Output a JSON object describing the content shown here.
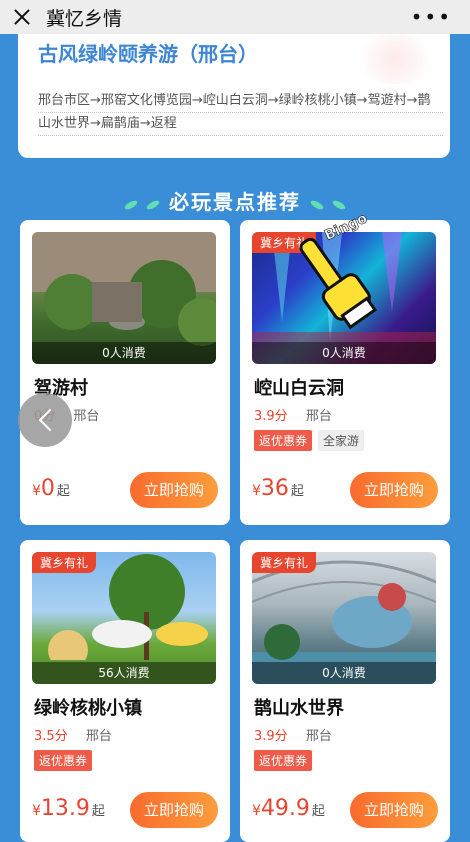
{
  "topbar": {
    "title": "冀忆乡情",
    "more": "•••"
  },
  "route": {
    "title": "古风绿岭颐养游（邢台）",
    "path_line1": "邢台市区→邢窑文化博览园→崆山白云洞→绿岭核桃小镇→驾遊村→鹊",
    "path_line2": "山水世界→扁鹊庙→返程"
  },
  "section": {
    "title": "必玩景点推荐"
  },
  "sticker": {
    "text": "Bingo"
  },
  "cards": [
    {
      "name": "驾游村",
      "consumed": "0人消费",
      "score": "0分",
      "city": "邢台",
      "badge": "",
      "tags": [],
      "currency": "¥",
      "price": "0",
      "qi": "起",
      "buy": "立即抢购"
    },
    {
      "name": "崆山白云洞",
      "consumed": "0人消费",
      "score": "3.9分",
      "city": "邢台",
      "badge": "冀乡有礼",
      "tags": [
        "返优惠券",
        "全家游"
      ],
      "currency": "¥",
      "price": "36",
      "qi": "起",
      "buy": "立即抢购"
    },
    {
      "name": "绿岭核桃小镇",
      "consumed": "56人消费",
      "score": "3.5分",
      "city": "邢台",
      "badge": "冀乡有礼",
      "tags": [
        "返优惠券"
      ],
      "currency": "¥",
      "price": "13.9",
      "qi": "起",
      "buy": "立即抢购"
    },
    {
      "name": "鹊山水世界",
      "consumed": "0人消费",
      "score": "3.9分",
      "city": "邢台",
      "badge": "冀乡有礼",
      "tags": [
        "返优惠券"
      ],
      "currency": "¥",
      "price": "49.9",
      "qi": "起",
      "buy": "立即抢购"
    }
  ]
}
